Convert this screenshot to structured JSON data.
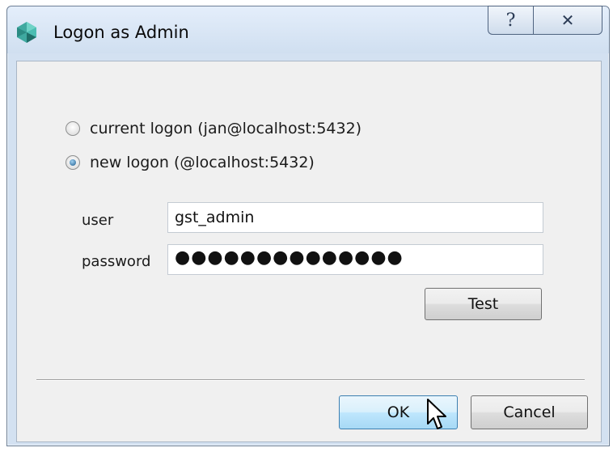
{
  "window": {
    "title": "Logon as Admin",
    "icon": "app-gem-icon",
    "help_glyph": "?",
    "close_glyph": "✕"
  },
  "logon_options": {
    "current_label": "current logon (jan@localhost:5432)",
    "current_selected": false,
    "new_label": "new logon (@localhost:5432)",
    "new_selected": true
  },
  "form": {
    "user_label": "user",
    "user_value": "gst_admin",
    "password_label": "password",
    "password_masked": "●●●●●●●●●●●●●●"
  },
  "buttons": {
    "test": "Test",
    "ok": "OK",
    "cancel": "Cancel"
  },
  "colors": {
    "titlebar": "#d3e1f1",
    "content": "#f0f0f0",
    "default_button": "#bee6fd"
  }
}
